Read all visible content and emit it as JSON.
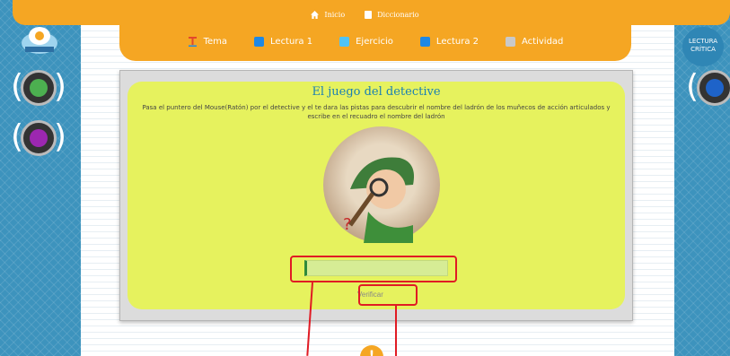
{
  "header": {
    "top_links": [
      {
        "icon": "home-icon",
        "label": "Inicio"
      },
      {
        "icon": "book-icon",
        "label": "Diccionario"
      }
    ],
    "nav": [
      {
        "icon": "letter-t-icon",
        "label": "Tema",
        "color": "#e2482c"
      },
      {
        "icon": "document-icon",
        "label": "Lectura 1",
        "color": "#1e88e5"
      },
      {
        "icon": "pencil-icon",
        "label": "Ejercicio",
        "color": "#4fc3f7"
      },
      {
        "icon": "document-icon",
        "label": "Lectura 2",
        "color": "#1e88e5"
      },
      {
        "icon": "list-icon",
        "label": "Actividad",
        "color": "#c9c9c9"
      }
    ]
  },
  "right_logo": {
    "line1": "LECTURA",
    "line2": "CRÍTICA"
  },
  "main": {
    "title": "El juego del detective",
    "instructions": "Pasa el puntero del Mouse(Ratón) por el detective y el te dara las pistas para descubrir el nombre del ladrón de los muñecos de acción articulados y escribe en el recuadro el nombre del ladrón",
    "answer_value": "",
    "verify_label": "Verificar"
  },
  "colors": {
    "orange": "#f5a623",
    "side": "#3d93bd",
    "panel_green": "#e6f25e",
    "highlight": "#e01b24"
  }
}
